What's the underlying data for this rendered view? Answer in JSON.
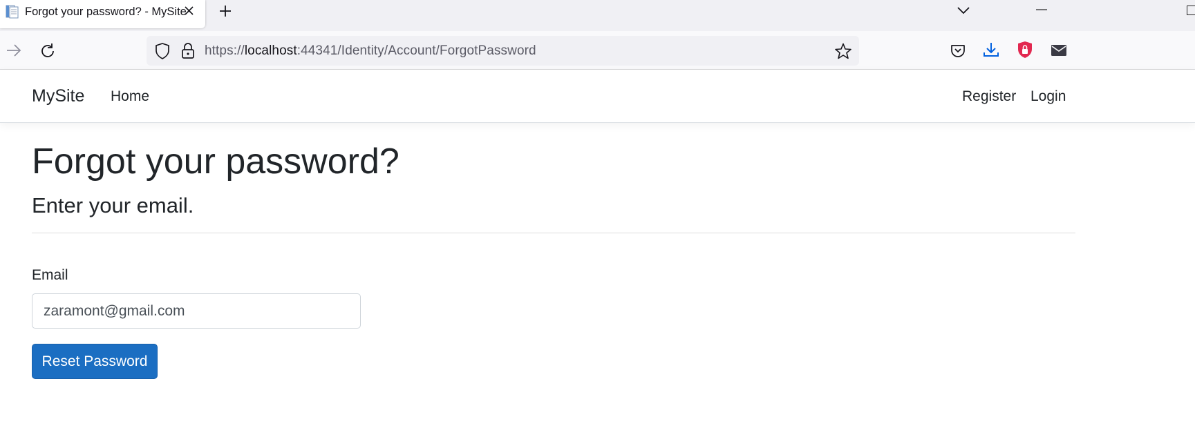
{
  "browser": {
    "tab": {
      "title": "Forgot your password? - MySite"
    },
    "url": {
      "scheme": "https://",
      "host": "localhost",
      "rest": ":44341/Identity/Account/ForgotPassword"
    }
  },
  "site": {
    "brand": "MySite",
    "nav": {
      "home": "Home",
      "register": "Register",
      "login": "Login"
    }
  },
  "page": {
    "title": "Forgot your password?",
    "subtitle": "Enter your email.",
    "form": {
      "email_label": "Email",
      "email_value": "zaramont@gmail.com",
      "submit_label": "Reset Password"
    }
  },
  "colors": {
    "primary_button": "#1b6ec2",
    "text": "#212529",
    "shield_red": "#e22850",
    "download_blue": "#0060df"
  },
  "icons": {
    "favicon": "page-icon",
    "tab_close": "close-icon",
    "new_tab": "plus-icon",
    "tab_list": "chevron-down-icon",
    "forward": "forward-arrow-icon",
    "reload": "reload-icon",
    "tracking": "shield-icon",
    "security": "lock-icon",
    "bookmark": "star-icon",
    "pocket": "pocket-icon",
    "downloads": "download-icon",
    "extension": "red-shield-lock-icon",
    "mail": "mail-icon"
  }
}
